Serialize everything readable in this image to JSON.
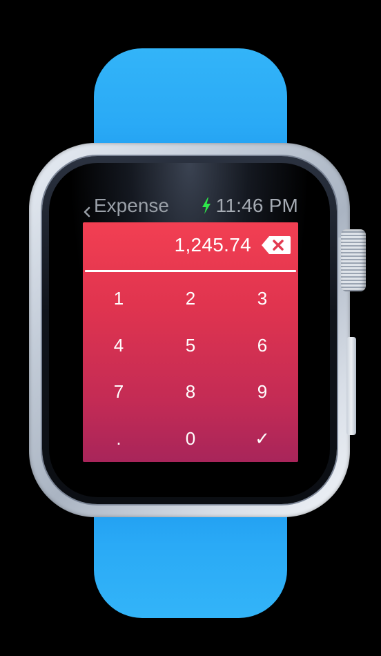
{
  "device": {
    "band_color": "#2aaaf6",
    "screen_background": "#000000"
  },
  "status_bar": {
    "back_label": "Expense",
    "back_icon": "chevron-left-icon",
    "charging_icon": "lightning-bolt-icon",
    "charging_color": "#2ee84a",
    "time": "11:46 PM"
  },
  "keypad": {
    "amount": "1,245.74",
    "delete_icon": "backspace-icon",
    "accent_gradient": [
      "#f23f52",
      "#a8255a"
    ],
    "keys": [
      "1",
      "2",
      "3",
      "4",
      "5",
      "6",
      "7",
      "8",
      "9",
      ".",
      "0",
      "✓"
    ]
  }
}
